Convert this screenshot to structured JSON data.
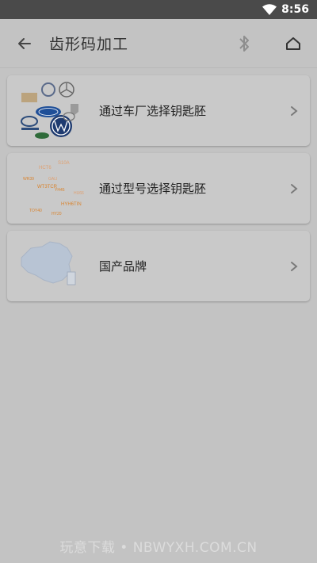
{
  "status_bar": {
    "time": "8:56",
    "icons": [
      "wifi-icon"
    ]
  },
  "app_bar": {
    "title": "齿形码加工",
    "icons": [
      "back-arrow-icon",
      "bluetooth-icon",
      "home-icon"
    ]
  },
  "menu": {
    "items": [
      {
        "label": "通过车厂选择钥匙胚",
        "thumbnail": "car-brand-logos"
      },
      {
        "label": "通过型号选择钥匙胚",
        "thumbnail": "key-model-codes"
      },
      {
        "label": "国产品牌",
        "thumbnail": "china-map"
      }
    ]
  },
  "thumb_codes": [
    "HCT6",
    "S10A",
    "WR39",
    "GALI",
    "WT3TCR",
    "YH45",
    "HYH6TIN",
    "HU66",
    "TOY40",
    "HY20"
  ],
  "watermark": "玩意下载 • NBWYXH.COM.CN",
  "colors": {
    "background": "#c3c3c3",
    "status_bar": "#4a4a4a",
    "card": "#c9c9c9",
    "code_orange": "#d9822b"
  }
}
